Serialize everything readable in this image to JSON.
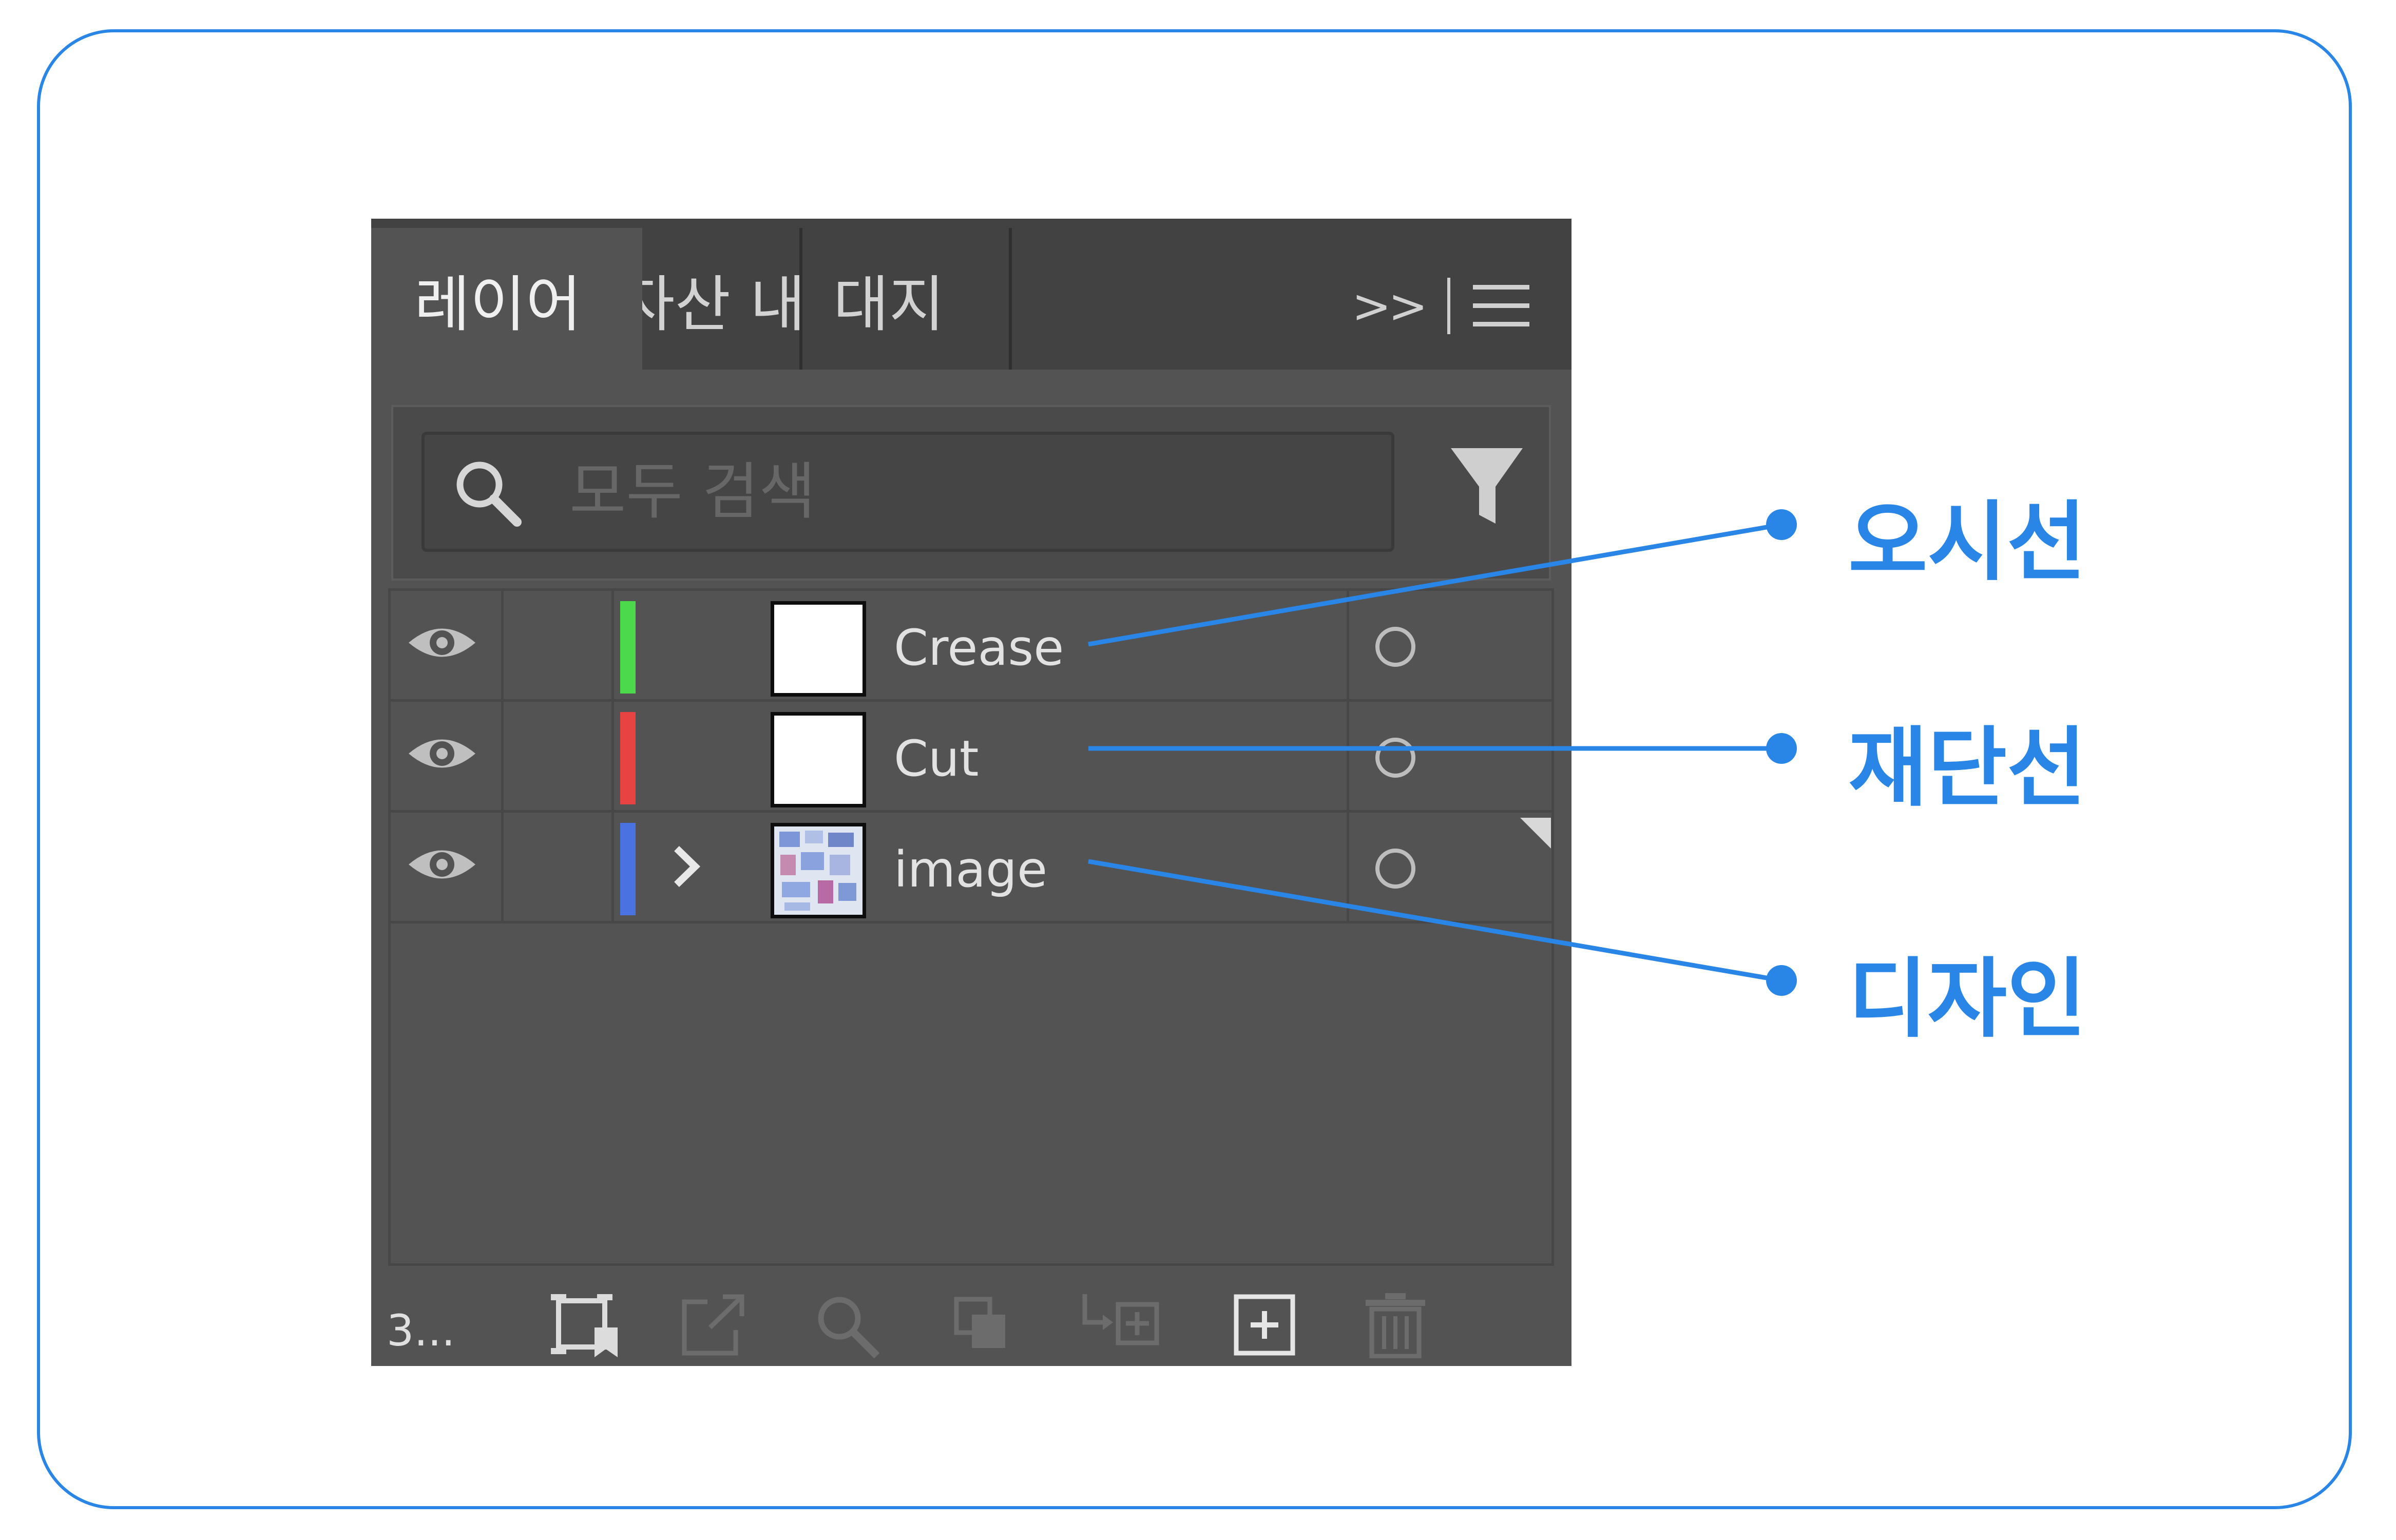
{
  "tabs": [
    {
      "label": "레이어",
      "active": true
    },
    {
      "label": "자산 내보",
      "active": false
    },
    {
      "label": "대지",
      "active": false
    }
  ],
  "search": {
    "placeholder": "모두 검색",
    "value": ""
  },
  "layers": [
    {
      "name": "Crease",
      "color": "#4cd94c",
      "thumbnail": "blank"
    },
    {
      "name": "Cut",
      "color": "#e84343",
      "thumbnail": "blank"
    },
    {
      "name": "image",
      "color": "#4a72e0",
      "thumbnail": "pattern",
      "expandable": true
    }
  ],
  "footer": {
    "layer_count": "3..."
  },
  "callouts": [
    {
      "label": "오시선",
      "target": "Crease"
    },
    {
      "label": "재단선",
      "target": "Cut"
    },
    {
      "label": "디자인",
      "target": "image"
    }
  ],
  "colors": {
    "accent": "#2a86e6",
    "panel": "#535353",
    "tabbar": "#424242"
  },
  "icons": [
    "overflow-chevron-icon",
    "panel-menu-icon",
    "search-icon",
    "filter-icon",
    "eye-icon",
    "expand-chevron-icon",
    "target-circle-icon",
    "collect-for-export-icon",
    "export-icon",
    "locate-object-icon",
    "make-clipping-mask-icon",
    "create-sublayer-icon",
    "new-layer-icon",
    "delete-layer-icon"
  ]
}
